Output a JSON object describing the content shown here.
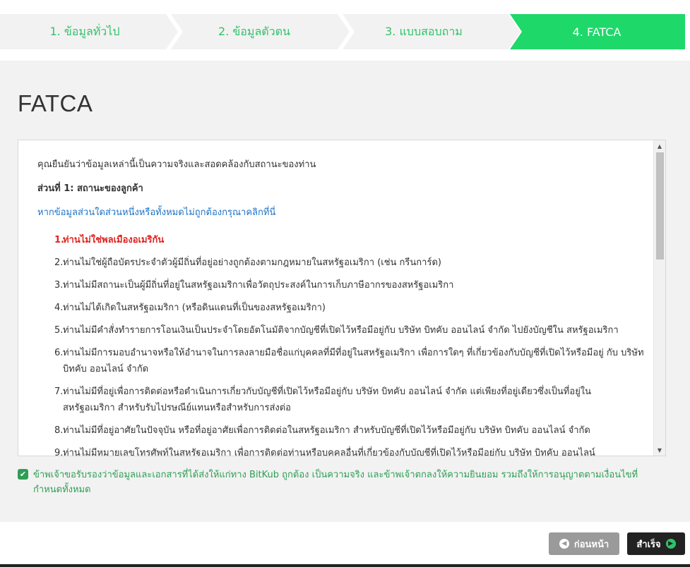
{
  "stepper": {
    "steps": [
      {
        "label": "1. ข้อมูลทั่วไป"
      },
      {
        "label": "2. ข้อมูลตัวตน"
      },
      {
        "label": "3. แบบสอบถาม"
      },
      {
        "label": "4. FATCA"
      }
    ],
    "active_index": 3,
    "colors": {
      "active": "#1ed86a",
      "inactive": "#f2f2f2",
      "text": "#2ec36a"
    }
  },
  "page": {
    "title": "FATCA"
  },
  "agreement": {
    "intro": "คุณยืนยันว่าข้อมูลเหล่านี้เป็นความจริงและสอดคล้องกับสถานะของท่าน",
    "section_title": "ส่วนที่ 1: สถานะของลูกค้า",
    "edit_link": "หากข้อมูลส่วนใดส่วนหนึ่งหรือทั้งหมดไม่ถูกต้องกรุณาคลิกที่นี่",
    "items": [
      {
        "num": "1.",
        "text": "ท่านไม่ใช่พลเมืองอเมริกัน"
      },
      {
        "num": "2.",
        "text": "ท่านไม่ใช่ผู้ถือบัตรประจำตัวผู้มีถิ่นที่อยู่อย่างถูกต้องตามกฎหมายในสหรัฐอเมริกา (เช่น กรีนการ์ด)"
      },
      {
        "num": "3.",
        "text": "ท่านไม่มีสถานะเป็นผู้มีถิ่นที่อยู่ในสหรัฐอเมริกาเพื่อวัตถุประสงค์ในการเก็บภาษีอากรของสหรัฐอเมริกา"
      },
      {
        "num": "4.",
        "text": "ท่านไม่ได้เกิดในสหรัฐอเมริกา (หรือดินแดนที่เป็นของสหรัฐอเมริกา)"
      },
      {
        "num": "5.",
        "text": "ท่านไม่มีคำสั่งทำรายการโอนเงินเป็นประจำโดยอัตโนมัติจากบัญชีที่เปิดไว้หรือมีอยู่กับ บริษัท บิทคับ ออนไลน์ จำกัด ไปยังบัญชีใน สหรัฐอเมริกา"
      },
      {
        "num": "6.",
        "text": "ท่านไม่มีการมอบอำนาจหรือให้อำนาจในการลงลายมือชื่อแก่บุคคลที่มีที่อยู่ในสหรัฐอเมริกา เพื่อการใดๆ ที่เกี่ยวข้องกับบัญชีที่เปิดไว้หรือมีอยู่ กับ บริษัท บิทคับ ออนไลน์ จำกัด"
      },
      {
        "num": "7.",
        "text": "ท่านไม่มีที่อยู่เพื่อการติดต่อหรือดำเนินการเกี่ยวกับบัญชีที่เปิดไว้หรือมีอยู่กับ บริษัท บิทคับ ออนไลน์ จำกัด แต่เพียงที่อยู่เดียวซึ่งเป็นที่อยู่ใน สหรัฐอเมริกา สำหรับรับไปรษณีย์แทนหรือสำหรับการส่งต่อ"
      },
      {
        "num": "8.",
        "text": "ท่านไม่มีที่อยู่อาศัยในปัจจุบัน หรือที่อยู่อาศัยเพื่อการติดต่อในสหรัฐอเมริกา สำหรับบัญชีที่เปิดไว้หรือมีอยู่กับ บริษัท บิทคับ ออนไลน์ จำกัด"
      },
      {
        "num": "9.",
        "text": "ท่านไม่มีหมายเลขโทรศัพท์ในสหรัฐอเมริกา เพื่อการติดต่อท่านหรือบุคคลอื่นที่เกี่ยวข้องกับบัญชีที่เปิดไว้หรือมีอยู่กับ บริษัท บิทคับ ออนไลน์"
      }
    ]
  },
  "consent": {
    "checked": true,
    "text": "ข้าพเจ้าขอรับรองว่าข้อมูลและเอกสารที่ได้ส่งให้แก่ทาง BitKub ถูกต้อง เป็นความจริง และข้าพเจ้าตกลงให้ความยินยอม รวมถึงให้การอนุญาตตามเงื่อนไขที่กำหนดทั้งหมด"
  },
  "buttons": {
    "back_label": "ก่อนหน้า",
    "done_label": "สำเร็จ"
  },
  "icons": {
    "back": "chevron-left-circle-icon",
    "done": "chevron-right-circle-icon",
    "check": "checkmark-icon"
  }
}
